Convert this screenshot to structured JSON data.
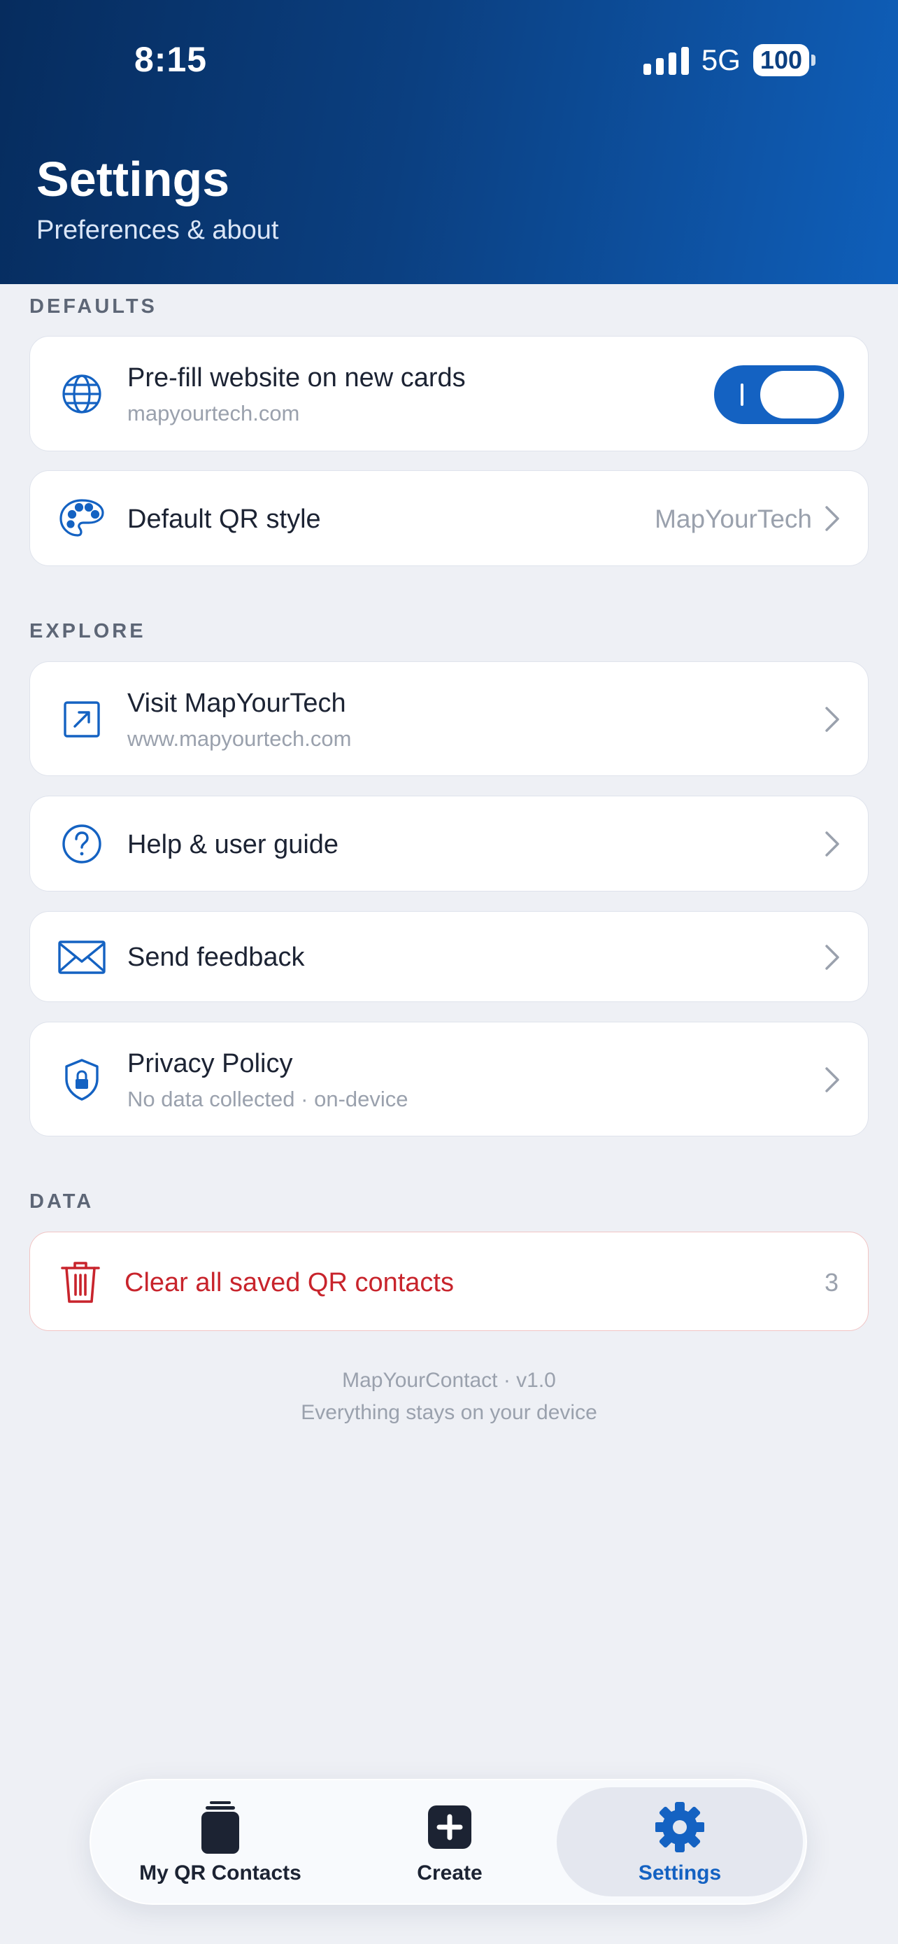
{
  "status_bar": {
    "time": "8:15",
    "network": "5G",
    "battery": "100"
  },
  "header": {
    "title": "Settings",
    "subtitle": "Preferences & about"
  },
  "defaults": {
    "label": "DEFAULTS",
    "prefill": {
      "title": "Pre-fill website on new cards",
      "subtitle": "mapyourtech.com",
      "enabled": true,
      "icon": "globe-icon"
    },
    "qr_style": {
      "title": "Default QR style",
      "value": "MapYourTech",
      "icon": "palette-icon"
    }
  },
  "explore": {
    "label": "EXPLORE",
    "items": [
      {
        "title": "Visit MapYourTech",
        "subtitle": "www.mapyourtech.com",
        "icon": "external-link-icon"
      },
      {
        "title": "Help & user guide",
        "subtitle": "",
        "icon": "help-circle-icon"
      },
      {
        "title": "Send feedback",
        "subtitle": "",
        "icon": "envelope-icon"
      },
      {
        "title": "Privacy Policy",
        "subtitle": "No data collected · on-device",
        "icon": "shield-lock-icon"
      }
    ]
  },
  "data_section": {
    "label": "DATA",
    "clear": {
      "title": "Clear all saved QR contacts",
      "count": "3",
      "icon": "trash-icon"
    }
  },
  "footer": {
    "version": "MapYourContact · v1.0",
    "note": "Everything stays on your device"
  },
  "tabbar": {
    "tabs": [
      {
        "label": "My QR Contacts",
        "icon": "cards-stack-icon",
        "active": false
      },
      {
        "label": "Create",
        "icon": "plus-square-icon",
        "active": false
      },
      {
        "label": "Settings",
        "icon": "gear-icon",
        "active": true
      }
    ]
  },
  "colors": {
    "accent": "#1462c2",
    "danger": "#c8242c",
    "header_dark": "#062c5e",
    "background": "#eef0f5"
  }
}
